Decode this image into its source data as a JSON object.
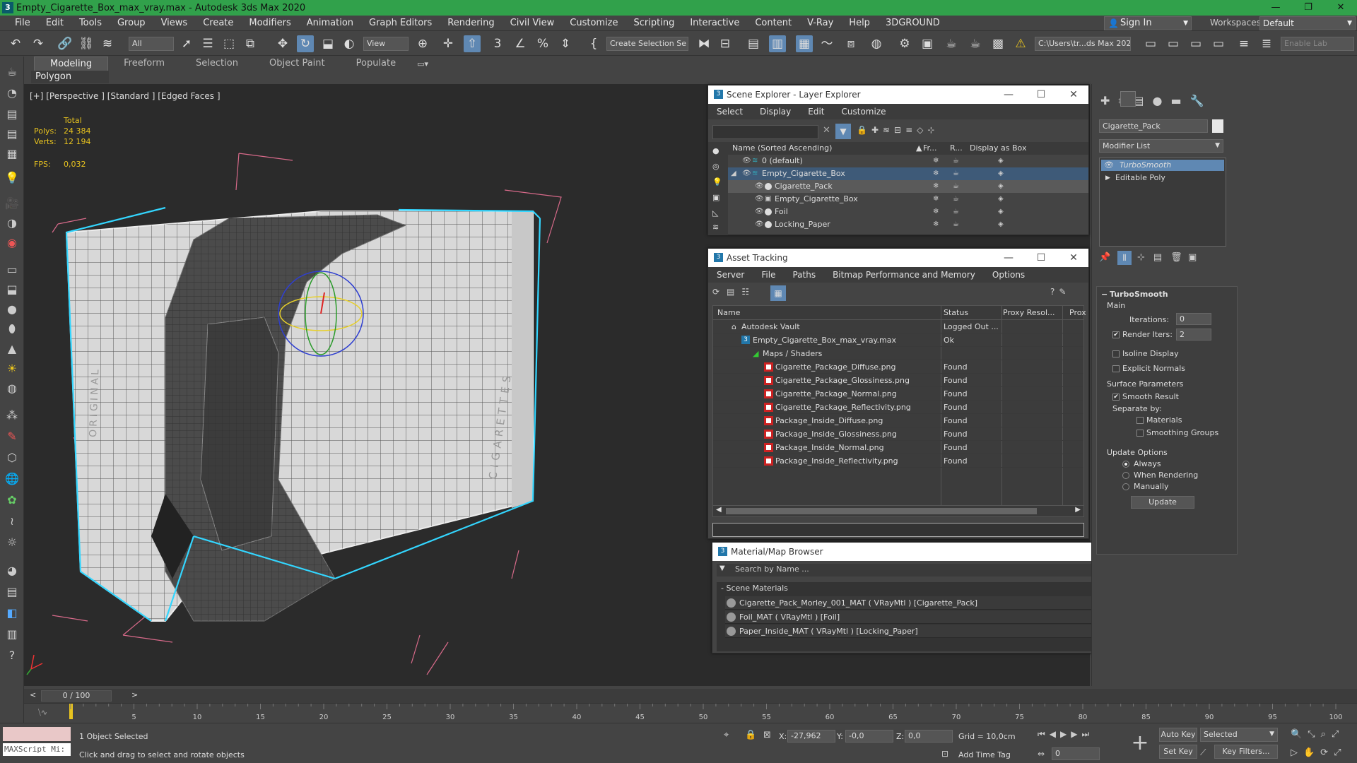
{
  "titlebar": {
    "app_icon": "3",
    "title": "Empty_Cigarette_Box_max_vray.max - Autodesk 3ds Max 2020",
    "min": "—",
    "max": "❐",
    "close": "✕"
  },
  "menu": {
    "items": [
      "File",
      "Edit",
      "Tools",
      "Group",
      "Views",
      "Create",
      "Modifiers",
      "Animation",
      "Graph Editors",
      "Rendering",
      "Civil View",
      "Customize",
      "Scripting",
      "Interactive",
      "Content",
      "V-Ray",
      "Help",
      "3DGROUND"
    ],
    "signin": "Sign In",
    "workspaces_label": "Workspaces:",
    "workspaces_value": "Default"
  },
  "toolbar": {
    "selection_filter": "All",
    "ref_coord": "View",
    "named_selection": "Create Selection Se",
    "project_path": "C:\\Users\\tr...ds Max 2020",
    "enable_label": "Enable Lab"
  },
  "ribbon": {
    "tabs": [
      "Modeling",
      "Freeform",
      "Selection",
      "Object Paint",
      "Populate"
    ],
    "panel": "Polygon Modeling"
  },
  "viewport": {
    "label": "[+] [Perspective ] [Standard ] [Edged Faces ]",
    "stats": {
      "total_label": "Total",
      "polys_label": "Polys:",
      "polys": "24 384",
      "verts_label": "Verts:",
      "verts": "12 194",
      "fps_label": "FPS:",
      "fps": "0,032"
    },
    "box_text_left": "ORIGINAL",
    "box_text_right": "CIGARETTES"
  },
  "scene_explorer": {
    "title": "Scene Explorer - Layer Explorer",
    "menu": [
      "Select",
      "Display",
      "Edit",
      "Customize"
    ],
    "columns": [
      "Name (Sorted Ascending)",
      "Fr...",
      "R...",
      "Display as Box"
    ],
    "rows": [
      {
        "name": "0 (default)"
      },
      {
        "name": "Empty_Cigarette_Box"
      },
      {
        "name": "Cigarette_Pack"
      },
      {
        "name": "Empty_Cigarette_Box"
      },
      {
        "name": "Foil"
      },
      {
        "name": "Locking_Paper"
      }
    ]
  },
  "asset_tracking": {
    "title": "Asset Tracking",
    "menu": [
      "Server",
      "File",
      "Paths",
      "Bitmap Performance and Memory",
      "Options"
    ],
    "columns": [
      "Name",
      "Status",
      "Proxy Resol...",
      "Prox"
    ],
    "rows": [
      {
        "name": "Autodesk Vault",
        "status": "Logged Out ..."
      },
      {
        "name": "Empty_Cigarette_Box_max_vray.max",
        "status": "Ok"
      },
      {
        "name": "Maps / Shaders",
        "status": ""
      },
      {
        "name": "Cigarette_Package_Diffuse.png",
        "status": "Found"
      },
      {
        "name": "Cigarette_Package_Glossiness.png",
        "status": "Found"
      },
      {
        "name": "Cigarette_Package_Normal.png",
        "status": "Found"
      },
      {
        "name": "Cigarette_Package_Reflectivity.png",
        "status": "Found"
      },
      {
        "name": "Package_Inside_Diffuse.png",
        "status": "Found"
      },
      {
        "name": "Package_Inside_Glossiness.png",
        "status": "Found"
      },
      {
        "name": "Package_Inside_Normal.png",
        "status": "Found"
      },
      {
        "name": "Package_Inside_Reflectivity.png",
        "status": "Found"
      }
    ]
  },
  "material_browser": {
    "title": "Material/Map Browser",
    "search_placeholder": "Search by Name ...",
    "group": "- Scene Materials",
    "rows": [
      "Cigarette_Pack_Morley_001_MAT  ( VRayMtl )  [Cigarette_Pack]",
      "Foil_MAT  ( VRayMtl )  [Foil]",
      "Paper_Inside_MAT  ( VRayMtl )  [Locking_Paper]"
    ]
  },
  "command_panel": {
    "object_name": "Cigarette_Pack",
    "modifier_list": "Modifier List",
    "stack": [
      "TurboSmooth",
      "Editable Poly"
    ],
    "rollout_title": "TurboSmooth",
    "main_label": "Main",
    "iterations_label": "Iterations:",
    "iterations": "0",
    "render_iters_label": "Render Iters:",
    "render_iters": "2",
    "isoline": "Isoline Display",
    "explicit_normals": "Explicit Normals",
    "surface_params": "Surface Parameters",
    "smooth_result": "Smooth Result",
    "separate_by": "Separate by:",
    "materials": "Materials",
    "smoothing_groups": "Smoothing Groups",
    "update_options": "Update Options",
    "always": "Always",
    "when_rendering": "When Rendering",
    "manually": "Manually",
    "update_btn": "Update"
  },
  "timeline": {
    "frame": "0 / 100",
    "ticks": [
      "5",
      "10",
      "15",
      "20",
      "25",
      "30",
      "35",
      "40",
      "45",
      "50",
      "55",
      "60",
      "65",
      "70",
      "75",
      "80",
      "85",
      "90",
      "95",
      "100"
    ],
    "current_frame": 0,
    "total_frames": 100
  },
  "status": {
    "maxscript": "MAXScript Mi:",
    "selected": "1 Object Selected",
    "prompt": "Click and drag to select and rotate objects",
    "x_label": "X:",
    "x": "-27,962",
    "y_label": "Y:",
    "y": "-0,0",
    "z_label": "Z:",
    "z": "0,0",
    "grid": "Grid = 10,0cm",
    "add_time_tag": "Add Time Tag",
    "auto_key": "Auto Key",
    "set_key": "Set Key",
    "key_mode": "Selected",
    "key_filters": "Key Filters...",
    "frame_field": "0"
  },
  "colors": {
    "titlebar": "#31a14b",
    "selection": "#5f88b3",
    "highlight_edges": "#33d6ff",
    "material_swatch": "#c01010"
  }
}
